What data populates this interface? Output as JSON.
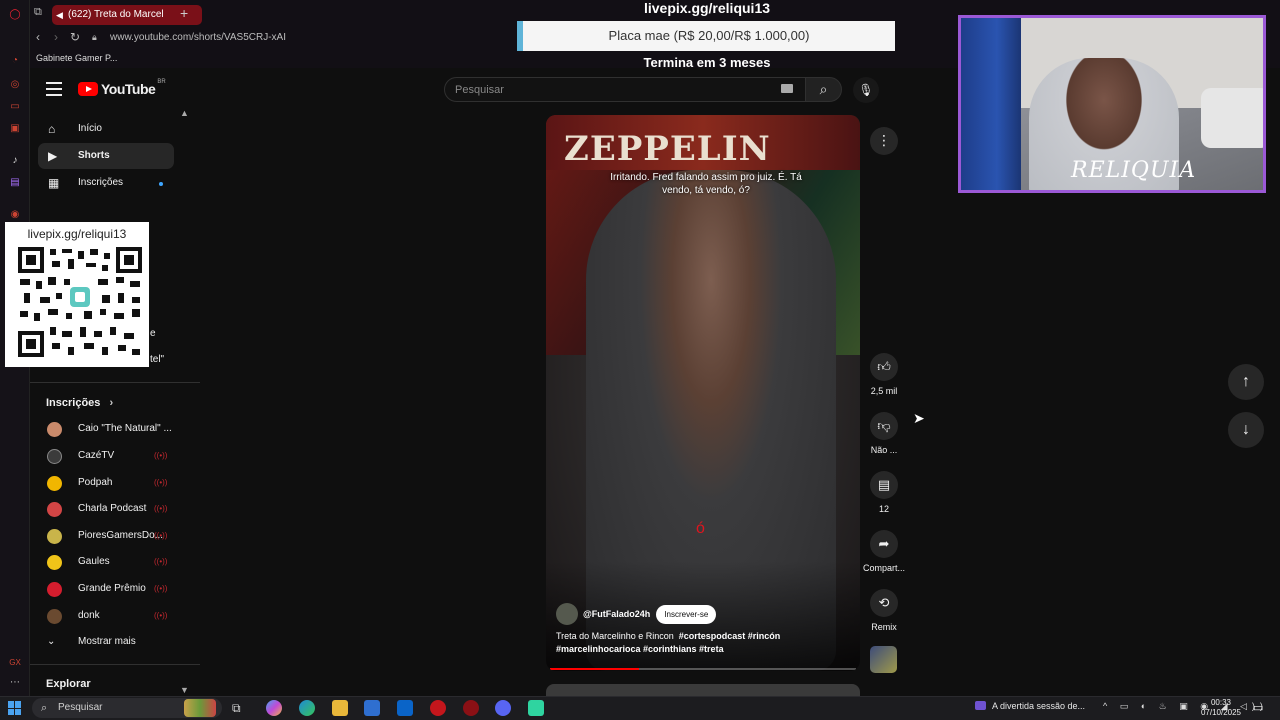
{
  "browser": {
    "tab_title": "(622) Treta do Marcel",
    "url": "www.youtube.com/shorts/VAS5CRJ-xAI",
    "bookmark": "Gabinete Gamer P..."
  },
  "youtube": {
    "logo_text": "YouTube",
    "logo_region": "BR",
    "search_placeholder": "Pesquisar"
  },
  "sidebar": {
    "nav": [
      {
        "label": "Início",
        "icon": "home-icon"
      },
      {
        "label": "Shorts",
        "icon": "shorts-icon"
      },
      {
        "label": "Inscrições",
        "icon": "subscriptions-icon"
      }
    ],
    "partial_texts": [
      "e",
      "tel\""
    ],
    "subs_title": "Inscrições",
    "channels": [
      {
        "name": "Caio \"The Natural\" ...",
        "color": "#c98a6b",
        "live": false
      },
      {
        "name": "CazéTV",
        "color": "#3b3b3b",
        "live": true
      },
      {
        "name": "Podpah",
        "color": "#f1b600",
        "live": true
      },
      {
        "name": "Charla Podcast",
        "color": "#d24545",
        "live": true
      },
      {
        "name": "PioresGamersDo...",
        "color": "#c9b44a",
        "live": true
      },
      {
        "name": "Gaules",
        "color": "#f0c419",
        "live": true
      },
      {
        "name": "Grande Prêmio",
        "color": "#d41d2e",
        "live": true
      },
      {
        "name": "donk",
        "color": "#6a4a30",
        "live": true
      }
    ],
    "show_more": "Mostrar mais",
    "explore_title": "Explorar"
  },
  "stream_overlay": {
    "qr_url": "livepix.gg/reliqui13",
    "top_url": "livepix.gg/reliqui13",
    "goal_text": "Placa mae (R$ 20,00/R$ 1.000,00)",
    "goal_progress": 0.02,
    "ends_text": "Termina em 3 meses",
    "webcam_watermark": "RELIQUIA"
  },
  "short": {
    "band_text": "ZEPPELIN",
    "caption": "Irritando. Fred falando assim pro juiz. É. Tá vendo, tá vendo, ó?",
    "bottom_caption": "ó",
    "channel": "@FutFalado24h",
    "subscribe_label": "Inscrever-se",
    "title": "Treta do Marcelinho e Rincon",
    "hashtags": "#cortespodcast #rincón #marcelinhocarioca #corinthians #treta",
    "progress": 0.29
  },
  "actions": {
    "like_count": "2,5 mil",
    "dislike_label": "Não ...",
    "comment_count": "12",
    "share_label": "Compart...",
    "remix_label": "Remix"
  },
  "taskbar": {
    "search_label": "Pesquisar",
    "news": "A divertida sessão de...",
    "time": "00:33",
    "date": "07/10/2025"
  }
}
